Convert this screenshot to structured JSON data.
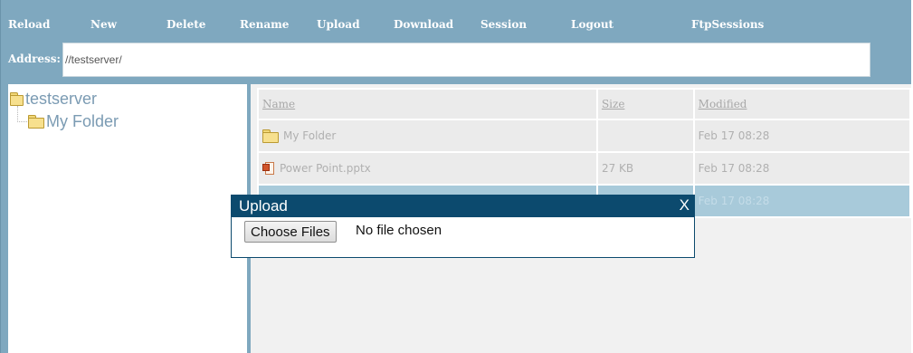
{
  "menu": {
    "items": [
      {
        "label": "Reload"
      },
      {
        "label": "New"
      },
      {
        "label": "Delete"
      },
      {
        "label": "Rename"
      },
      {
        "label": "Upload"
      },
      {
        "label": "Download"
      },
      {
        "label": "Session"
      },
      {
        "label": "Logout"
      },
      {
        "label": "FtpSessions"
      }
    ]
  },
  "address": {
    "label": "Address:",
    "value": "//testserver/"
  },
  "tree": {
    "root": {
      "label": "testserver",
      "icon": "folder-icon"
    },
    "child": {
      "label": "My Folder",
      "icon": "folder-icon"
    }
  },
  "files": {
    "headers": {
      "name": "Name",
      "size": "Size",
      "modified": "Modified"
    },
    "rows": [
      {
        "name": "My Folder",
        "size": "",
        "modified": "Feb 17 08:28",
        "icon": "folder-icon"
      },
      {
        "name": "Power Point.pptx",
        "size": "27 KB",
        "modified": "Feb 17 08:28",
        "icon": "powerpoint-file-icon"
      },
      {
        "name": "",
        "size": "",
        "modified": "Feb 17 08:28",
        "selected": true
      }
    ]
  },
  "upload_dialog": {
    "title": "Upload",
    "close_label": "X",
    "choose_button": "Choose Files",
    "file_status": "No file chosen"
  },
  "colors": {
    "frame": "#7fa8bf",
    "dialog_header": "#0c4a6e",
    "selected_row": "#a8cada"
  }
}
